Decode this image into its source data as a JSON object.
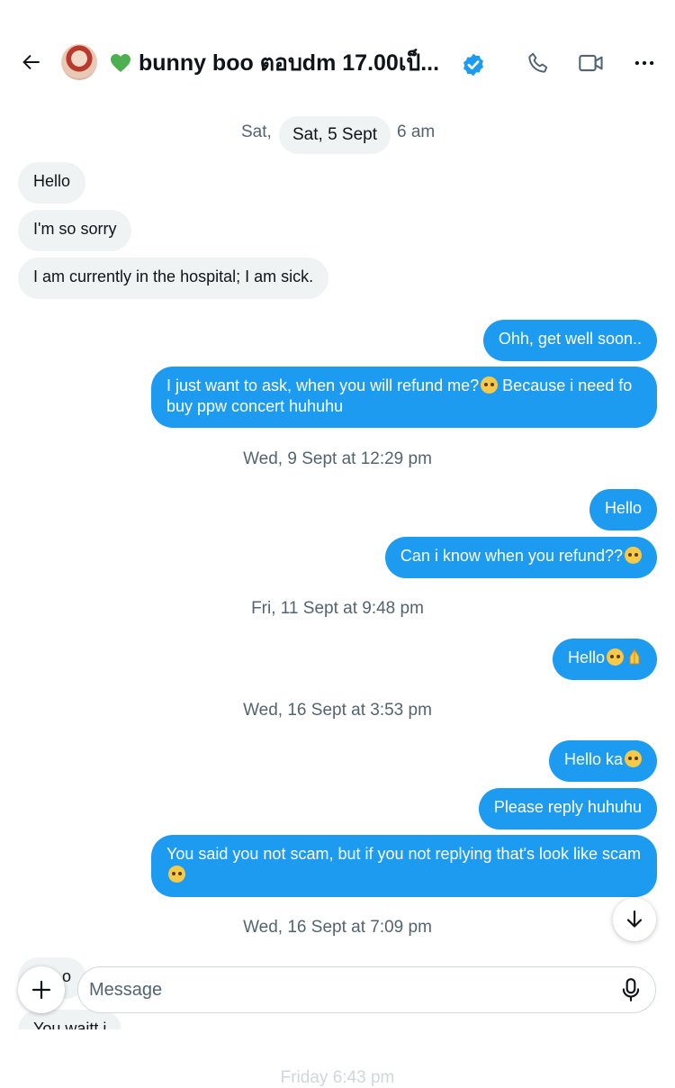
{
  "header": {
    "title": "bunny boo ตอบdm 17.00เป็...",
    "back_icon": "arrow-left-icon",
    "heart_icon": "green-heart-icon",
    "verified_icon": "verified-badge-icon",
    "call_icon": "phone-icon",
    "video_icon": "video-camera-icon",
    "more_icon": "more-horizontal-icon"
  },
  "conversation": {
    "sticky_date": "Sat, 5 Sept",
    "partial_ts_left": "Sat,",
    "partial_ts_right": "6 am",
    "ts_wed9": "Wed, 9 Sept at 12:29 pm",
    "ts_fri11": "Fri, 11 Sept at 9:48 pm",
    "ts_wed16a": "Wed, 16 Sept at 3:53 pm",
    "ts_wed16b": "Wed, 16 Sept at 7:09 pm",
    "ts_friday": "Friday 6:43 pm",
    "in_hello": "Hello",
    "in_sorry": "I'm so sorry",
    "in_hospital": "I am currently in the hospital; I am sick.",
    "out_getwell": "Ohh, get well soon..",
    "out_refund_ask": "I just want to ask, when you will refund me?",
    "out_refund_ask_2": " Because i need fo buy ppw concert huhuhu",
    "out_hello_1": "Hello",
    "out_refund_know": "Can i know when you refund??",
    "out_hello_2": "Hello",
    "out_hello_ka": "Hello ka",
    "out_please": "Please reply huhuhu",
    "out_scam": "You said you not scam, but if you not replying that's look like scam",
    "in_partial_1": "o",
    "in_partial_2": "You waitt i"
  },
  "composer": {
    "placeholder": "Message",
    "add_icon": "plus-icon",
    "mic_icon": "microphone-icon",
    "scroll_icon": "arrow-down-icon"
  },
  "colors": {
    "accent": "#1d9bf0",
    "incoming_bubble": "#eff3f4",
    "timestamp": "#536471",
    "heart": "#4caf50"
  }
}
